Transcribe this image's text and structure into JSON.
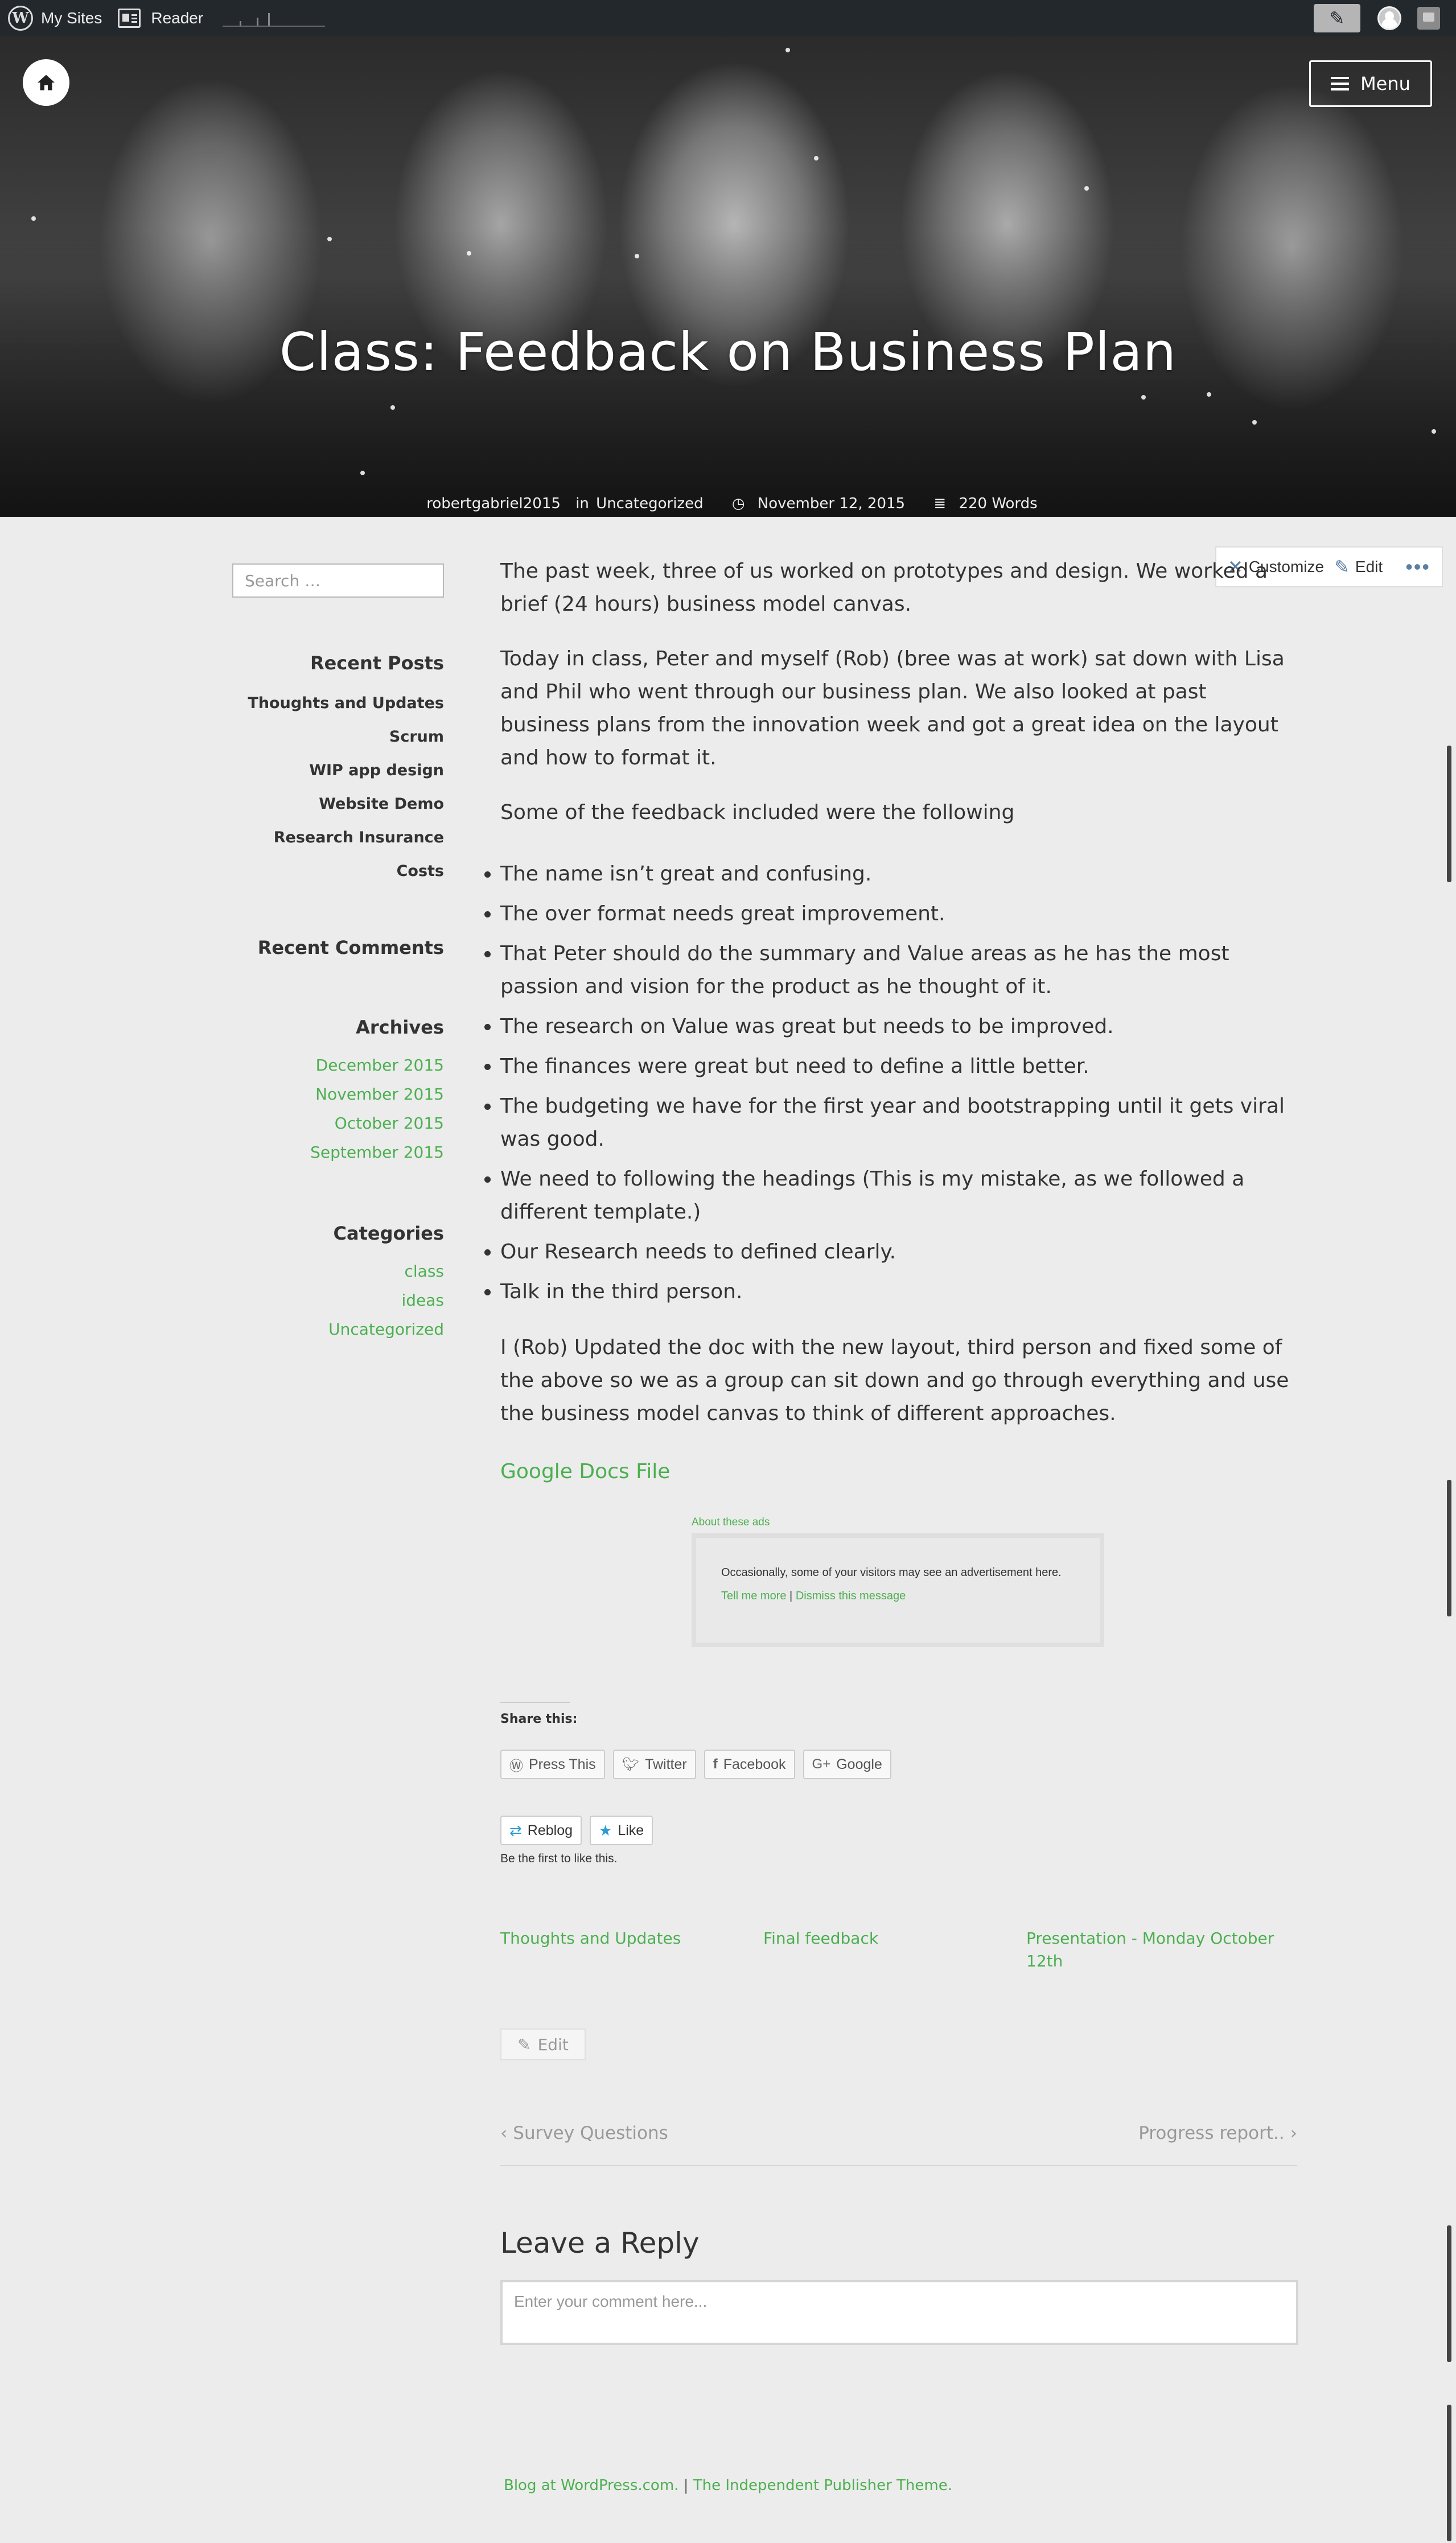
{
  "adminbar": {
    "my_sites": "My Sites",
    "reader": "Reader",
    "logo_icon": "wordpress-logo-icon",
    "write_icon": "write-icon",
    "avatar_icon": "avatar-icon",
    "notifications_icon": "notifications-icon"
  },
  "hero": {
    "title": "Class: Feedback on Business Plan",
    "author": "robertgabriel2015",
    "in_label": "in",
    "category": "Uncategorized",
    "date": "November 12, 2015",
    "word_count": "220 Words",
    "menu_label": "Menu",
    "home_icon": "home-icon"
  },
  "toolbar": {
    "customize": "Customize",
    "edit": "Edit",
    "more": "•••"
  },
  "sidebar": {
    "search_placeholder": "Search …",
    "recent_posts_title": "Recent Posts",
    "recent_posts": [
      "Thoughts and Updates",
      "Scrum",
      "WIP app design",
      "Website Demo",
      "Research Insurance Costs"
    ],
    "recent_comments_title": "Recent Comments",
    "archives_title": "Archives",
    "archives": [
      "December 2015",
      "November 2015",
      "October 2015",
      "September 2015"
    ],
    "categories_title": "Categories",
    "categories": [
      "class",
      "ideas",
      "Uncategorized"
    ]
  },
  "post": {
    "paragraphs": [
      "The past week, three of us worked on prototypes and design. We worked a brief (24 hours) business model canvas.",
      "Today in class, Peter and myself (Rob) (bree was at work) sat down with Lisa and Phil who went through our business plan. We also looked at past business plans from the innovation week and got a great idea on the layout and how to format it.",
      "Some of the feedback included were the following"
    ],
    "bullets": [
      "The name isn’t great and confusing.",
      "The over format needs great improvement.",
      "That Peter should do the summary and Value areas as he has the most passion and vision for the product as he thought of it.",
      "The research on Value was great but needs to be improved.",
      "The finances were great but need to define a little better.",
      "The budgeting we have for the first year and bootstrapping until it gets viral was good.",
      "We need to following the headings (This is my mistake, as we followed a different template.)",
      "Our Research needs to defined clearly.",
      "Talk in the third person."
    ],
    "closing": "I (Rob) Updated the doc with the new layout, third person and fixed some of the above so we as a group can sit down and go through everything and use the business model canvas to think of different approaches.",
    "docs_link": "Google Docs File"
  },
  "ad": {
    "about": "About these ads",
    "message": "Occasionally, some of your visitors may see an advertisement here.",
    "tell_more": "Tell me more",
    "separator": "|",
    "dismiss": "Dismiss this message"
  },
  "share": {
    "title": "Share this:",
    "buttons": [
      "Press This",
      "Twitter",
      "Facebook",
      "Google"
    ]
  },
  "like": {
    "reblog": "Reblog",
    "like": "Like",
    "first": "Be the first to like this."
  },
  "related": [
    "Thoughts and Updates",
    "Final feedback",
    "Presentation - Monday October 12th"
  ],
  "edit_label": "Edit",
  "nav": {
    "prev": "Survey Questions",
    "next": "Progress report.."
  },
  "reply": {
    "title": "Leave a Reply",
    "placeholder": "Enter your comment here..."
  },
  "footer": {
    "blog": "Blog at WordPress.com.",
    "separator": "|",
    "theme": "The Independent Publisher Theme."
  },
  "colors": {
    "accent": "#4caf50",
    "adminbar": "#23282d",
    "background": "#ececec"
  }
}
